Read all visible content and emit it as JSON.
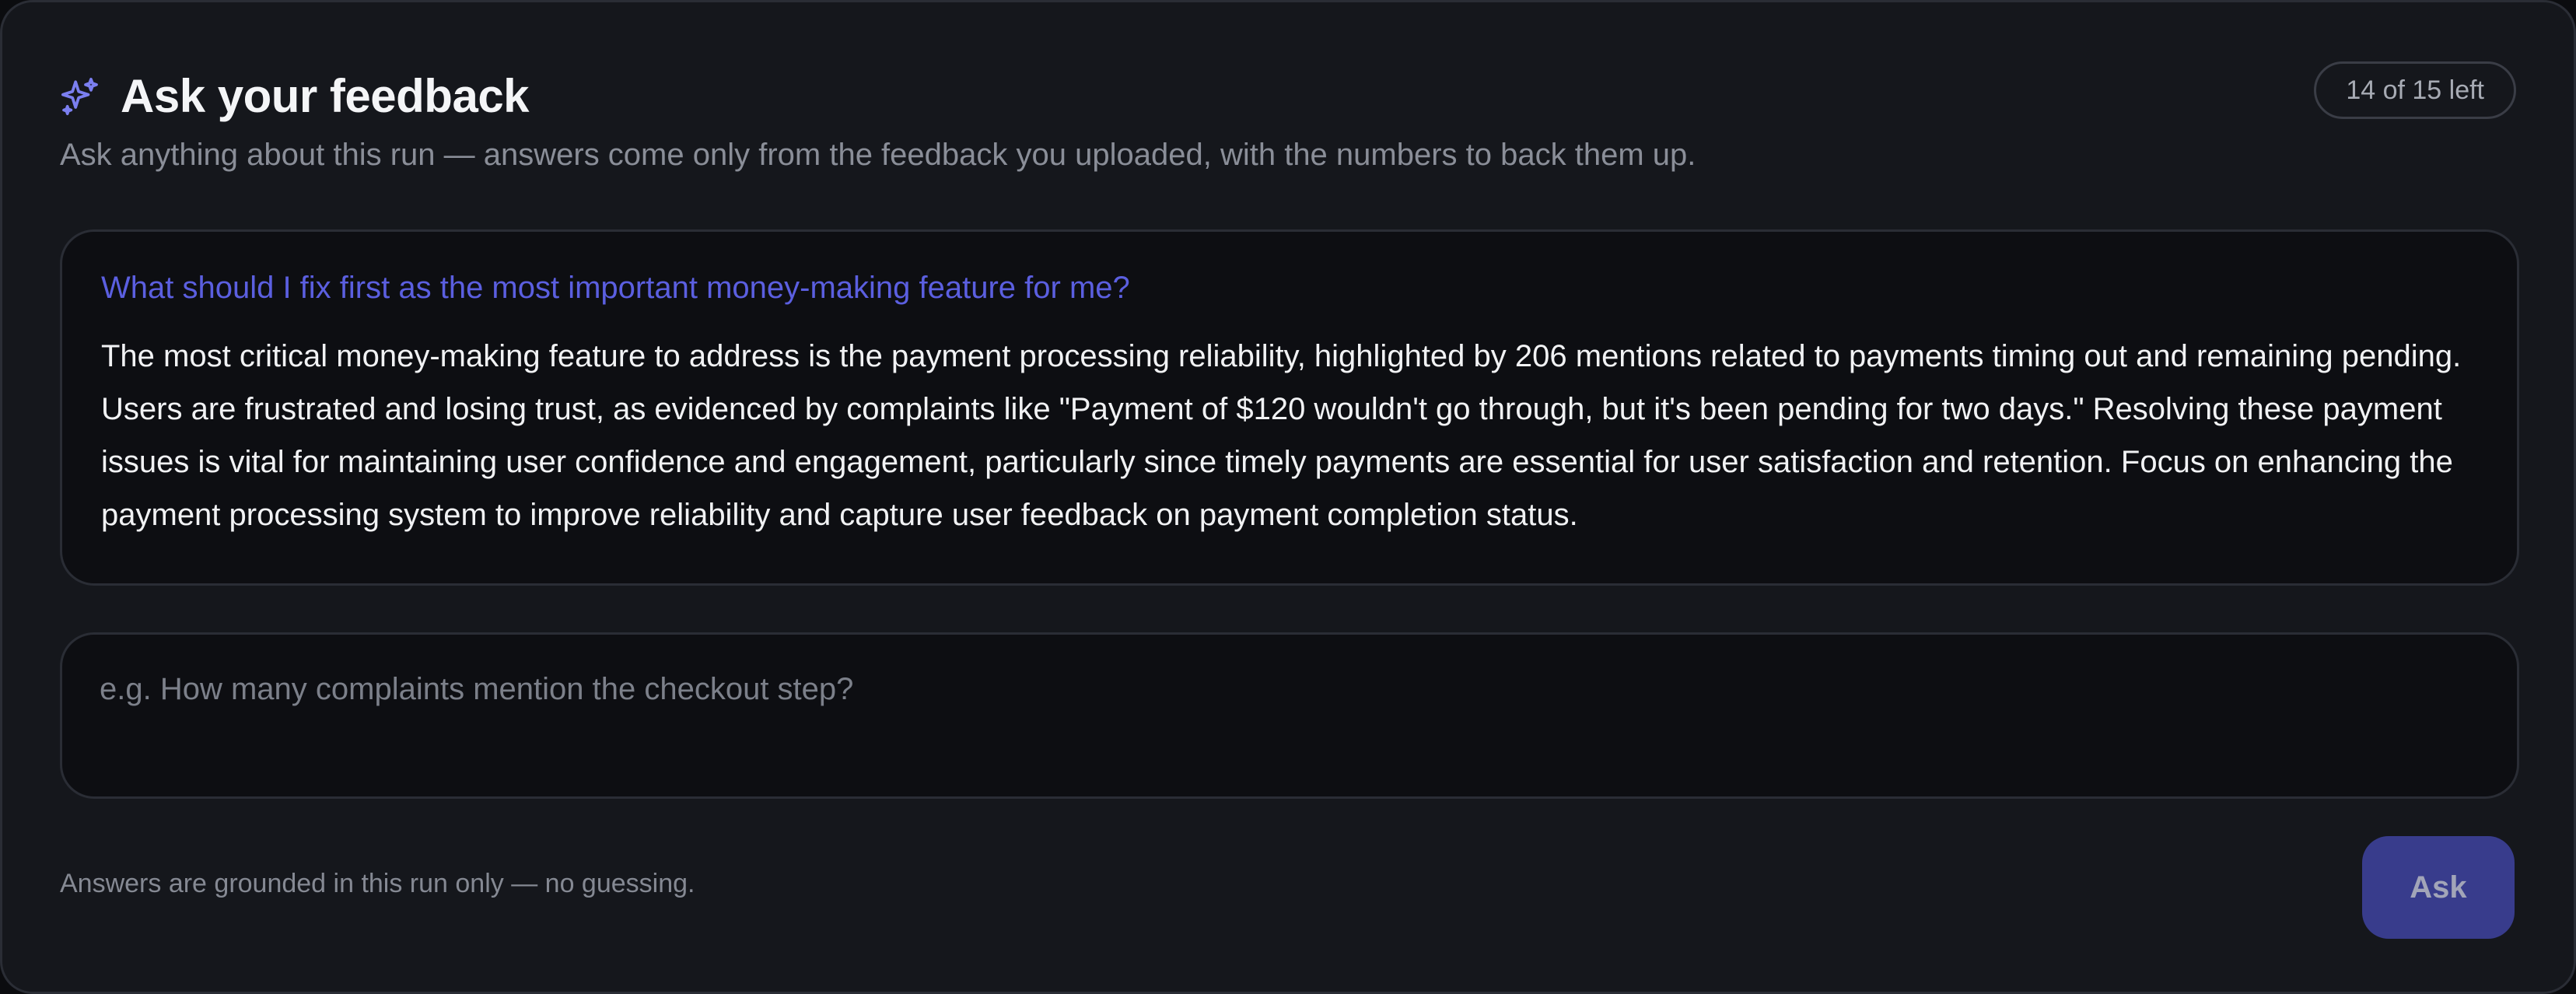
{
  "header": {
    "title": "Ask your feedback",
    "subtitle": "Ask anything about this run — answers come only from the feedback you uploaded, with the numbers to back them up.",
    "icon": "sparkles-icon",
    "quota_label": "14 of 15 left"
  },
  "conversation": {
    "question": "What should I fix first as the most important money-making feature for me?",
    "answer": "The most critical money-making feature to address is the payment processing reliability, highlighted by 206 mentions related to payments timing out and remaining pending. Users are frustrated and losing trust, as evidenced by complaints like \"Payment of $120 wouldn't go through, but it's been pending for two days.\" Resolving these payment issues is vital for maintaining user confidence and engagement, particularly since timely payments are essential for user satisfaction and retention. Focus on enhancing the payment processing system to improve reliability and capture user feedback on payment completion status."
  },
  "input": {
    "value": "",
    "placeholder": "e.g. How many complaints mention the checkout step?"
  },
  "footer": {
    "note": "Answers are grounded in this run only — no guessing.",
    "ask_label": "Ask"
  },
  "colors": {
    "accent": "#5b5fe0",
    "button": "#383c8c",
    "panel": "#15171c",
    "card": "#0d0e12"
  }
}
